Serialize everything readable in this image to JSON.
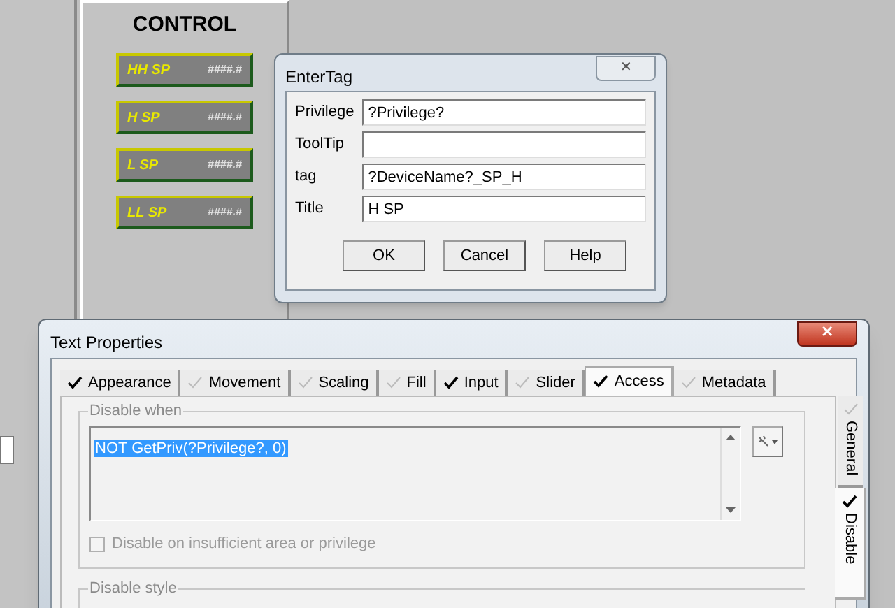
{
  "control_panel": {
    "title": "CONTROL",
    "setpoints": [
      {
        "label": "HH SP",
        "value": "####.#"
      },
      {
        "label": "H SP",
        "value": "####.#"
      },
      {
        "label": "L SP",
        "value": "####.#"
      },
      {
        "label": "LL SP",
        "value": "####.#"
      }
    ]
  },
  "enter_tag_dialog": {
    "title": "EnterTag",
    "close": "✕",
    "fields": [
      {
        "label": "Privilege",
        "value": "?Privilege?"
      },
      {
        "label": "ToolTip"
      },
      {
        "label": "tag",
        "value": "?DeviceName?_SP_H"
      },
      {
        "label": "Title",
        "value": "H SP"
      }
    ],
    "buttons": [
      "OK",
      "Cancel",
      "Help"
    ]
  },
  "text_properties_dialog": {
    "title": "Text Properties",
    "close": "✕",
    "tabs": [
      {
        "label": "Appearance",
        "checked": true,
        "selected": false
      },
      {
        "label": "Movement",
        "checked": false,
        "selected": false
      },
      {
        "label": "Scaling",
        "checked": false,
        "selected": false
      },
      {
        "label": "Fill",
        "checked": false,
        "selected": false
      },
      {
        "label": "Input",
        "checked": true,
        "selected": false
      },
      {
        "label": "Slider",
        "checked": false,
        "selected": false
      },
      {
        "label": "Access",
        "checked": true,
        "selected": true
      },
      {
        "label": "Metadata",
        "checked": false,
        "selected": false
      }
    ],
    "side_tabs": [
      {
        "label": "General",
        "checked": false,
        "selected": false
      },
      {
        "label": "Disable",
        "checked": true,
        "selected": true
      }
    ],
    "disable_when": {
      "legend": "Disable when",
      "expression": "NOT GetPriv(?Privilege?, 0)"
    },
    "checkbox": {
      "label": "Disable on insufficient area or privilege",
      "checked": false,
      "disabled": true
    },
    "disable_style": {
      "legend": "Disable style"
    }
  }
}
